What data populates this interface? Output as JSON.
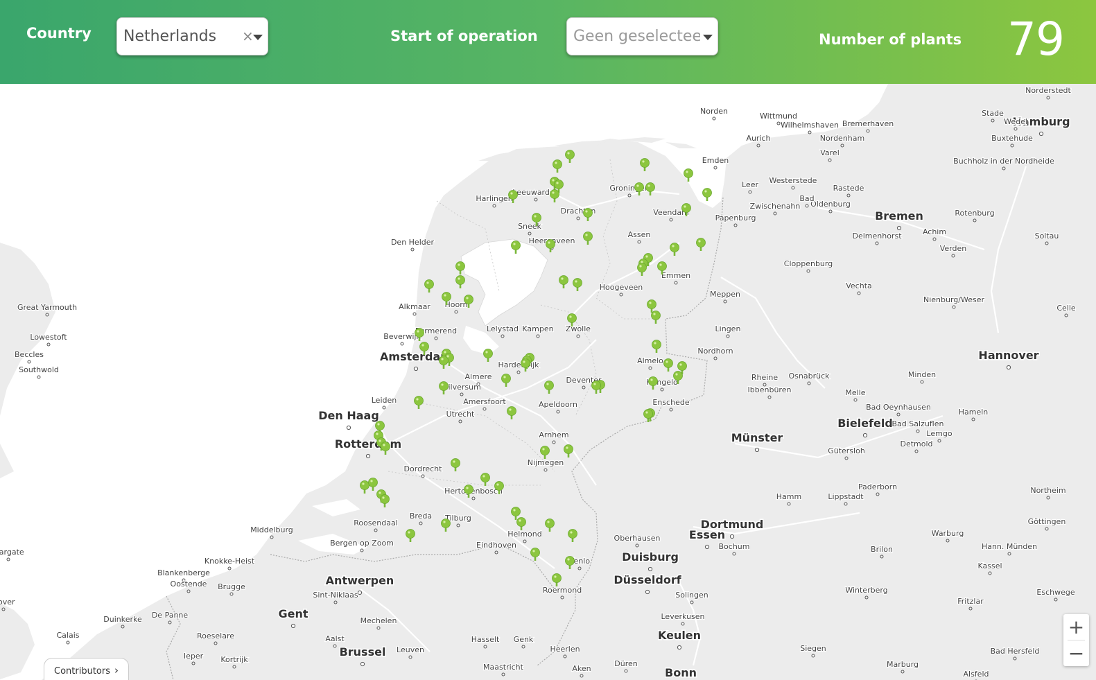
{
  "filters": {
    "country_label": "Country",
    "country_value": "Netherlands",
    "clear_symbol": "×",
    "start_label": "Start of operation",
    "start_placeholder": "Geen geselecteerd",
    "count_label": "Number of plants",
    "count_value": "79"
  },
  "colors": {
    "header_start": "#3aa66c",
    "header_end": "#8cc63f",
    "pin": "#8cc63f",
    "land": "#ececec",
    "sea": "#ffffff"
  },
  "map": {
    "zoom_in_label": "+",
    "zoom_out_label": "−",
    "contributors_label": "Contributors",
    "cities": [
      {
        "name": "Amsterdam",
        "major": true
      },
      {
        "name": "Den Haag",
        "major": true
      },
      {
        "name": "Rotterdam",
        "major": true
      },
      {
        "name": "Bremen",
        "major": true
      },
      {
        "name": "Hamburg",
        "major": true
      },
      {
        "name": "Münster",
        "major": true
      },
      {
        "name": "Hannover",
        "major": true
      },
      {
        "name": "Bielefeld",
        "major": true
      },
      {
        "name": "Dortmund",
        "major": true
      },
      {
        "name": "Essen",
        "major": true
      },
      {
        "name": "Duisburg",
        "major": true
      },
      {
        "name": "Düsseldorf",
        "major": true
      },
      {
        "name": "Keulen",
        "major": true
      },
      {
        "name": "Antwerpen",
        "major": true
      },
      {
        "name": "Gent",
        "major": true
      },
      {
        "name": "Brussel",
        "major": true
      },
      {
        "name": "Bonn",
        "major": true
      },
      {
        "name": "Leeuwarden"
      },
      {
        "name": "Harlingen"
      },
      {
        "name": "Groningen"
      },
      {
        "name": "Drachten"
      },
      {
        "name": "Sneek"
      },
      {
        "name": "Heerenveen"
      },
      {
        "name": "Den Helder"
      },
      {
        "name": "Assen"
      },
      {
        "name": "Veendam"
      },
      {
        "name": "Emmen"
      },
      {
        "name": "Hoogeveen"
      },
      {
        "name": "Alkmaar"
      },
      {
        "name": "Hoorn"
      },
      {
        "name": "Purmerend"
      },
      {
        "name": "Beverwijk"
      },
      {
        "name": "Lelystad"
      },
      {
        "name": "Kampen"
      },
      {
        "name": "Zwolle"
      },
      {
        "name": "Harderwijk"
      },
      {
        "name": "Almere"
      },
      {
        "name": "Hilversum"
      },
      {
        "name": "Amersfoort"
      },
      {
        "name": "Leiden"
      },
      {
        "name": "Utrecht"
      },
      {
        "name": "Apeldoorn"
      },
      {
        "name": "Deventer"
      },
      {
        "name": "Almelo"
      },
      {
        "name": "Hengelo"
      },
      {
        "name": "Enschede"
      },
      {
        "name": "Arnhem"
      },
      {
        "name": "Nijmegen"
      },
      {
        "name": "Dordrecht"
      },
      {
        "name": "Hertogenbosch"
      },
      {
        "name": "Breda"
      },
      {
        "name": "Tilburg"
      },
      {
        "name": "Roosendaal"
      },
      {
        "name": "Eindhoven"
      },
      {
        "name": "Helmond"
      },
      {
        "name": "Venlo"
      },
      {
        "name": "Roermond"
      },
      {
        "name": "Middelburg"
      },
      {
        "name": "Bergen op Zoom"
      },
      {
        "name": "Maastricht"
      },
      {
        "name": "Heerlen"
      },
      {
        "name": "Aken"
      },
      {
        "name": "Norden"
      },
      {
        "name": "Wittmund"
      },
      {
        "name": "Wilhelmshaven"
      },
      {
        "name": "Bremerhaven"
      },
      {
        "name": "Aurich"
      },
      {
        "name": "Nordenham"
      },
      {
        "name": "Emden"
      },
      {
        "name": "Varel"
      },
      {
        "name": "Leer"
      },
      {
        "name": "Westerstede"
      },
      {
        "name": "Rastede"
      },
      {
        "name": "Oldenburg"
      },
      {
        "name": "Papenburg"
      },
      {
        "name": "Delmenhorst"
      },
      {
        "name": "Achim"
      },
      {
        "name": "Rotenburg"
      },
      {
        "name": "Verden"
      },
      {
        "name": "Soltau"
      },
      {
        "name": "Cloppenburg"
      },
      {
        "name": "Vechta"
      },
      {
        "name": "Meppen"
      },
      {
        "name": "Lingen"
      },
      {
        "name": "Nordhorn"
      },
      {
        "name": "Rheine"
      },
      {
        "name": "Ibbenbüren"
      },
      {
        "name": "Osnabrück"
      },
      {
        "name": "Minden"
      },
      {
        "name": "Melle"
      },
      {
        "name": "Hameln"
      },
      {
        "name": "Gütersloh"
      },
      {
        "name": "Detmold"
      },
      {
        "name": "Lemgo"
      },
      {
        "name": "Paderborn"
      },
      {
        "name": "Lippstadt"
      },
      {
        "name": "Hamm"
      },
      {
        "name": "Oberhausen"
      },
      {
        "name": "Bochum"
      },
      {
        "name": "Solingen"
      },
      {
        "name": "Leverkusen"
      },
      {
        "name": "Siegen"
      },
      {
        "name": "Düren"
      },
      {
        "name": "Göttingen"
      },
      {
        "name": "Kassel"
      },
      {
        "name": "Warburg"
      },
      {
        "name": "Brilon"
      },
      {
        "name": "Winterberg"
      },
      {
        "name": "Marburg"
      },
      {
        "name": "Bad Hersfeld"
      },
      {
        "name": "Alsfeld"
      },
      {
        "name": "Eschwege"
      },
      {
        "name": "Fritzlar"
      },
      {
        "name": "Northeim"
      },
      {
        "name": "Celle"
      },
      {
        "name": "Stade"
      },
      {
        "name": "Wedel"
      },
      {
        "name": "Buxtehude"
      },
      {
        "name": "Norderstedt"
      },
      {
        "name": "Buchholz in der Nordheide"
      },
      {
        "name": "Nienburg/Weser"
      },
      {
        "name": "Knokke-Heist"
      },
      {
        "name": "Blankenberge"
      },
      {
        "name": "Oostende"
      },
      {
        "name": "Brugge"
      },
      {
        "name": "Sint-Niklaas"
      },
      {
        "name": "Mechelen"
      },
      {
        "name": "Aalst"
      },
      {
        "name": "Leuven"
      },
      {
        "name": "Hasselt"
      },
      {
        "name": "Genk"
      },
      {
        "name": "Roeselare"
      },
      {
        "name": "Kortrijk"
      },
      {
        "name": "Ieper"
      },
      {
        "name": "Duinkerke"
      },
      {
        "name": "De Panne"
      },
      {
        "name": "Calais"
      },
      {
        "name": "Dover"
      },
      {
        "name": "Margate"
      },
      {
        "name": "Great Yarmouth"
      },
      {
        "name": "Lowestoft"
      },
      {
        "name": "Beccles"
      },
      {
        "name": "Southwold"
      },
      {
        "name": "Bad Oeynhausen"
      },
      {
        "name": "Bad Salzuflen"
      },
      {
        "name": "Zwischenahn"
      },
      {
        "name": "Bad"
      },
      {
        "name": "Hann. Münden"
      }
    ]
  }
}
